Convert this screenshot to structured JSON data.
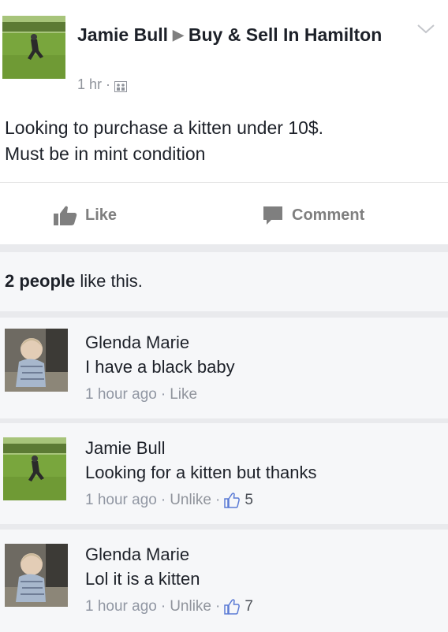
{
  "post": {
    "author": "Jamie Bull",
    "group": "Buy & Sell In Hamilton",
    "time": "1 hr",
    "meta_sep": "·",
    "text_line1": "Looking to purchase a kitten under 10$.",
    "text_line2": "Must be in mint condition",
    "like_label": "Like",
    "comment_label": "Comment",
    "audience_icon": "group-audience-icon",
    "menu_icon": "chevron-down-icon"
  },
  "likes_summary": {
    "count_text": "2 people",
    "suffix": " like this."
  },
  "comments": [
    {
      "name": "Glenda Marie",
      "text": "I have a black baby",
      "time": "1 hour ago",
      "sep": "·",
      "action": "Like"
    },
    {
      "name": "Jamie Bull",
      "text": "Looking for a kitten but thanks",
      "time": "1 hour ago",
      "sep": "·",
      "action": "Unlike",
      "sep2": "·",
      "likes": "5"
    },
    {
      "name": "Glenda Marie",
      "text": "Lol it is a kitten",
      "time": "1 hour ago",
      "sep": "·",
      "action": "Unlike",
      "sep2": "·",
      "likes": "7"
    }
  ],
  "colors": {
    "text": "#1d2129",
    "meta": "#90949c",
    "action": "#7f7f7f",
    "thumb_outline": "#5b7bd5"
  }
}
